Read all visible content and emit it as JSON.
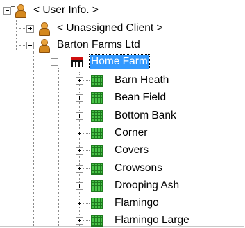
{
  "tree": {
    "root": {
      "label": "< User Info. >",
      "icon": "user-icon"
    },
    "clients": [
      {
        "label": "< Unassigned Client >",
        "icon": "client-icon",
        "expanded": false
      },
      {
        "label": "Barton Farms Ltd",
        "icon": "client-icon",
        "expanded": true
      }
    ],
    "farm": {
      "label": "Home Farm",
      "icon": "farm-icon",
      "selected": true
    },
    "fields": [
      {
        "label": "Barn Heath",
        "icon": "field-icon"
      },
      {
        "label": "Bean Field",
        "icon": "field-icon"
      },
      {
        "label": "Bottom Bank",
        "icon": "field-icon"
      },
      {
        "label": "Corner",
        "icon": "field-icon"
      },
      {
        "label": "Covers",
        "icon": "field-icon"
      },
      {
        "label": "Crowsons",
        "icon": "field-icon"
      },
      {
        "label": "Drooping Ash",
        "icon": "field-icon"
      },
      {
        "label": "Flamingo",
        "icon": "field-icon"
      },
      {
        "label": "Flamingo Large",
        "icon": "field-icon"
      }
    ]
  },
  "colors": {
    "selection": "#3399ff",
    "field_green": "#49c449",
    "farm_red": "#d01010"
  }
}
